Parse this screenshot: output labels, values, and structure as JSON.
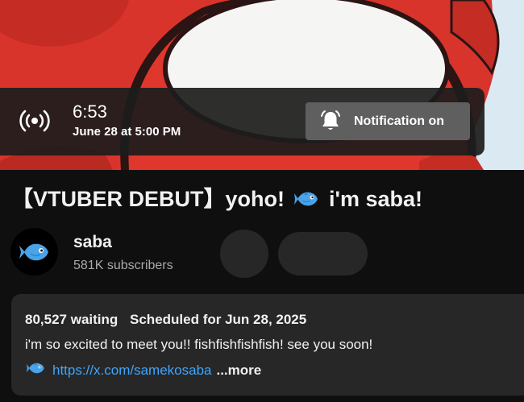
{
  "premiere": {
    "time": "6:53",
    "date": "June 28 at 5:00 PM",
    "notification_label": "Notification on"
  },
  "video": {
    "title_prefix": "【VTUBER DEBUT】yoho!",
    "title_suffix": "i'm saba!"
  },
  "channel": {
    "name": "saba",
    "subscribers": "581K subscribers"
  },
  "description": {
    "waiting": "80,527 waiting",
    "scheduled": "Scheduled for Jun 28, 2025",
    "text": "i'm so excited to meet you!! fishfishfishfish! see you soon!",
    "link": "https://x.com/samekosaba",
    "more_label": "...more"
  },
  "colors": {
    "background": "#0f0f0f",
    "link": "#3ea6ff",
    "thumbnail_red": "#d9342b",
    "button_gray": "#5f5f5f"
  },
  "icons": [
    "live-broadcast-icon",
    "bell-icon",
    "fish-emoji-icon"
  ]
}
